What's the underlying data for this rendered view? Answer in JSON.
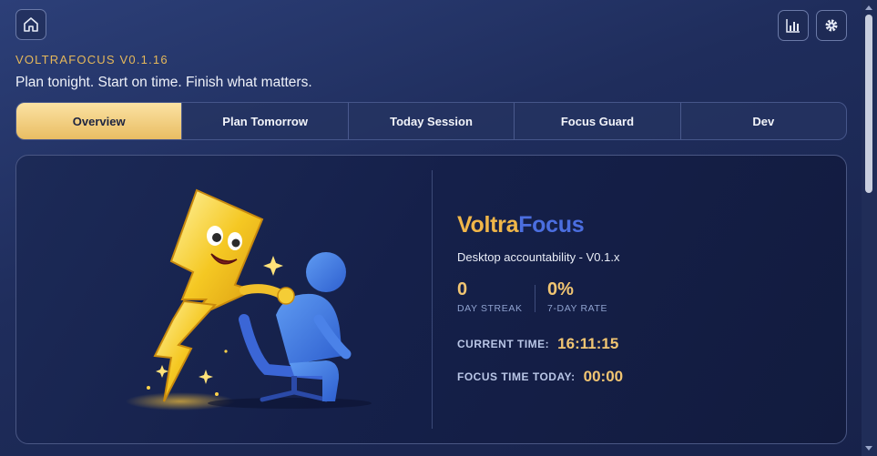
{
  "header": {
    "version": "VOLTRAFOCUS V0.1.16",
    "tagline": "Plan tonight. Start on time. Finish what matters.",
    "icons": {
      "home": "home-icon",
      "stats": "bar-chart-icon",
      "settings": "gear-icon"
    }
  },
  "tabs": [
    {
      "label": "Overview",
      "active": true
    },
    {
      "label": "Plan Tomorrow",
      "active": false
    },
    {
      "label": "Today Session",
      "active": false
    },
    {
      "label": "Focus Guard",
      "active": false
    },
    {
      "label": "Dev",
      "active": false
    }
  ],
  "overview": {
    "brand_part1": "Voltra",
    "brand_part2": "Focus",
    "subtitle": "Desktop accountability - V0.1.x",
    "stats": [
      {
        "value": "0",
        "label": "DAY STREAK"
      },
      {
        "value": "0%",
        "label": "7-DAY RATE"
      }
    ],
    "current_time_label": "CURRENT TIME:",
    "current_time_value": "16:11:15",
    "focus_label": "FOCUS TIME TODAY:",
    "focus_value": "00:00"
  },
  "colors": {
    "accent_gold": "#f1c572",
    "brand_blue": "#4b6ee0",
    "background": "#1f2d5c"
  }
}
